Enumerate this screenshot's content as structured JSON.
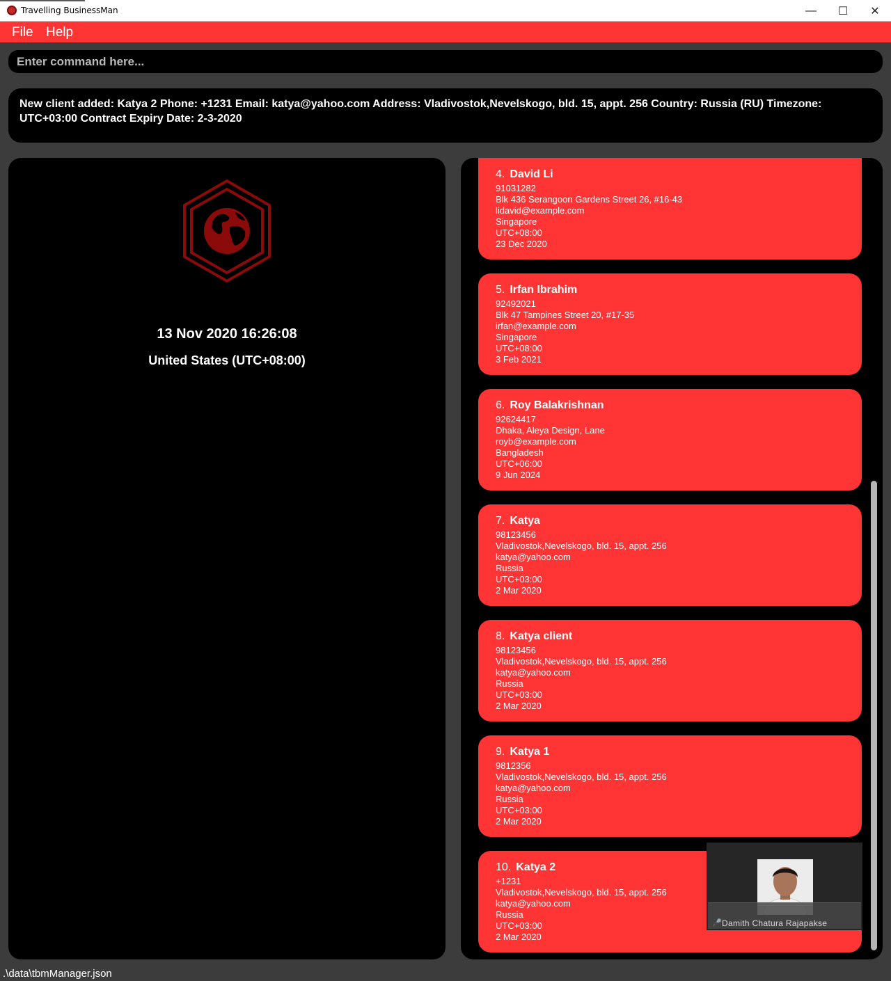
{
  "window": {
    "title": "Travelling BusinessMan",
    "minimize_glyph": "—",
    "maximize_glyph": "☐",
    "close_glyph": "✕"
  },
  "menu": {
    "file": "File",
    "help": "Help"
  },
  "command": {
    "placeholder": "Enter command here...",
    "value": ""
  },
  "result": {
    "text": "New client added: Katya 2 Phone: +1231 Email: katya@yahoo.com Address: Vladivostok,Nevelskogo, bld. 15, appt. 256 Country: Russia (RU) Timezone: UTC+03:00 Contract Expiry Date: 2-3-2020"
  },
  "clock": {
    "datetime": "13 Nov 2020 16:26:08",
    "country_timezone": "United States (UTC+08:00)",
    "logo_icon": "globe-hexagon-icon"
  },
  "clients": [
    {
      "index": "4.",
      "name": "David Li",
      "phone": "91031282",
      "address": "Blk 436 Serangoon Gardens Street 26, #16-43",
      "email": "lidavid@example.com",
      "country": "Singapore",
      "timezone": "UTC+08:00",
      "expiry": "23 Dec 2020"
    },
    {
      "index": "5.",
      "name": "Irfan Ibrahim",
      "phone": "92492021",
      "address": "Blk 47 Tampines Street 20, #17-35",
      "email": "irfan@example.com",
      "country": "Singapore",
      "timezone": "UTC+08:00",
      "expiry": "3 Feb 2021"
    },
    {
      "index": "6.",
      "name": "Roy Balakrishnan",
      "phone": "92624417",
      "address": "Dhaka, Aleya Design, Lane",
      "email": "royb@example.com",
      "country": "Bangladesh",
      "timezone": "UTC+06:00",
      "expiry": "9 Jun 2024"
    },
    {
      "index": "7.",
      "name": "Katya",
      "phone": "98123456",
      "address": "Vladivostok,Nevelskogo, bld. 15, appt. 256",
      "email": "katya@yahoo.com",
      "country": "Russia",
      "timezone": "UTC+03:00",
      "expiry": "2 Mar 2020"
    },
    {
      "index": "8.",
      "name": "Katya client",
      "phone": "98123456",
      "address": "Vladivostok,Nevelskogo, bld. 15, appt. 256",
      "email": "katya@yahoo.com",
      "country": "Russia",
      "timezone": "UTC+03:00",
      "expiry": "2 Mar 2020"
    },
    {
      "index": "9.",
      "name": "Katya 1",
      "phone": "9812356",
      "address": "Vladivostok,Nevelskogo, bld. 15, appt. 256",
      "email": "katya@yahoo.com",
      "country": "Russia",
      "timezone": "UTC+03:00",
      "expiry": "2 Mar 2020"
    },
    {
      "index": "10.",
      "name": "Katya 2",
      "phone": "+1231",
      "address": "Vladivostok,Nevelskogo, bld. 15, appt. 256",
      "email": "katya@yahoo.com",
      "country": "Russia",
      "timezone": "UTC+03:00",
      "expiry": "2 Mar 2020"
    }
  ],
  "video_overlay": {
    "participant_name": "Damith Chatura Rajapakse",
    "mic_icon": "mic-muted-icon"
  },
  "status": {
    "file_path": ".\\data\\tbmManager.json"
  },
  "colors": {
    "accent": "#ff3535",
    "panel": "#000000",
    "background": "#3c3c3c",
    "logo": "#8b0b0b"
  }
}
